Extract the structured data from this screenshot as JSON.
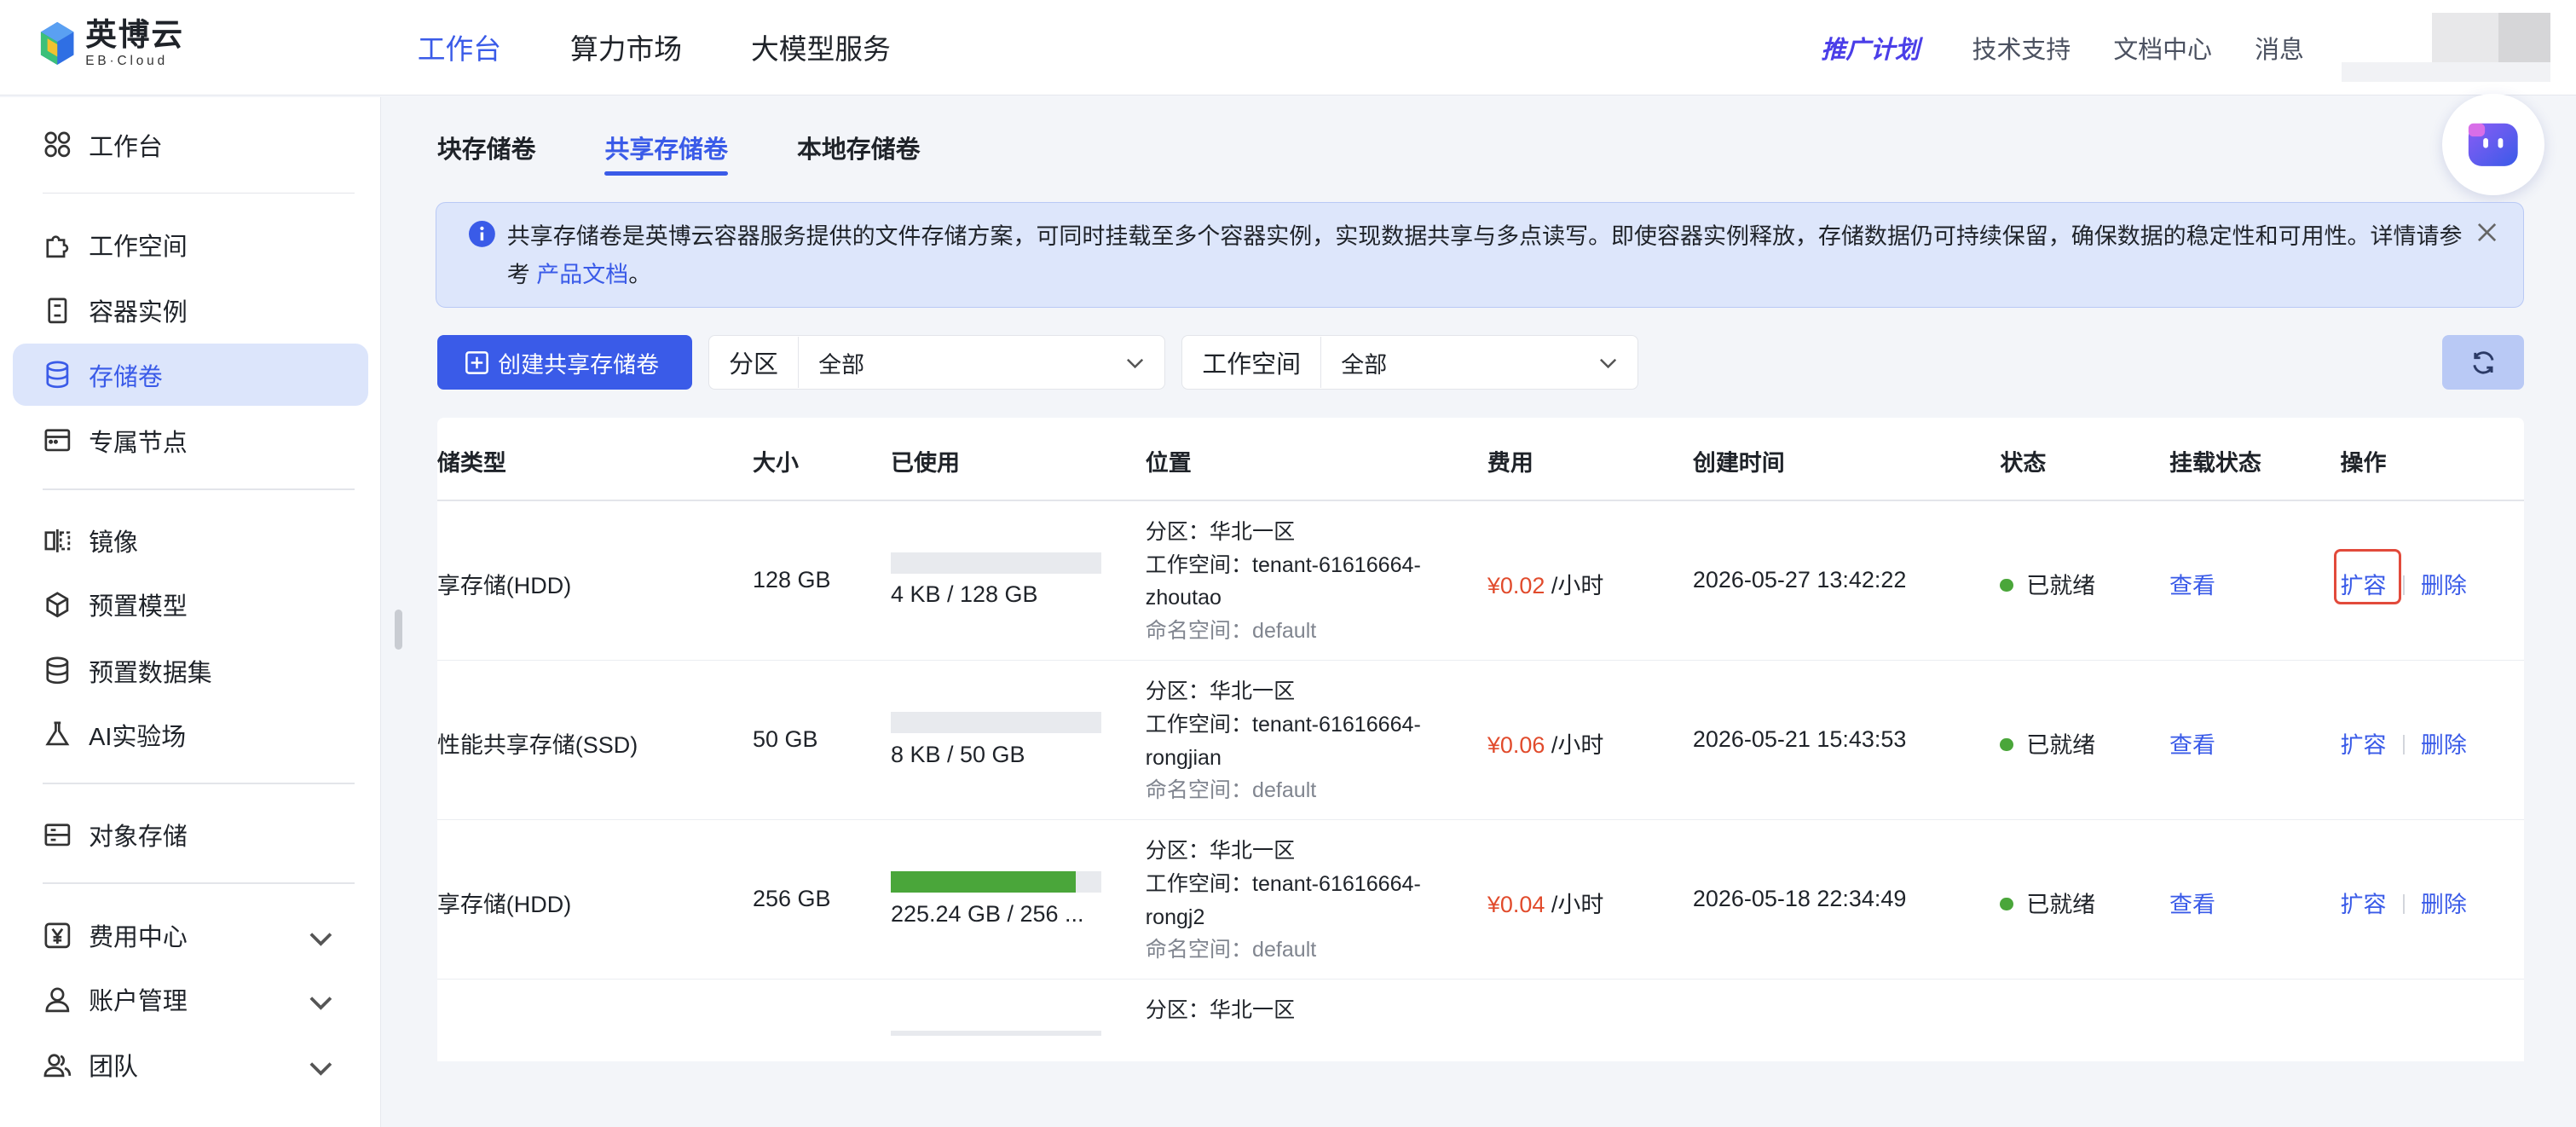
{
  "brand": {
    "name_cn": "英博云",
    "name_en": "EB·Cloud"
  },
  "topnav": {
    "items": [
      {
        "label": "工作台",
        "active": true
      },
      {
        "label": "算力市场",
        "active": false
      },
      {
        "label": "大模型服务",
        "active": false
      }
    ],
    "promo": "推广计划",
    "links": [
      "技术支持",
      "文档中心",
      "消息"
    ]
  },
  "sidebar": {
    "items": [
      {
        "label": "工作台",
        "icon": "grid-icon"
      },
      {
        "label": "工作空间",
        "icon": "puzzle-icon"
      },
      {
        "label": "容器实例",
        "icon": "container-icon"
      },
      {
        "label": "存储卷",
        "icon": "database-icon",
        "active": true
      },
      {
        "label": "专属节点",
        "icon": "node-icon"
      },
      {
        "label": "镜像",
        "icon": "mirror-icon"
      },
      {
        "label": "预置模型",
        "icon": "cube-icon"
      },
      {
        "label": "预置数据集",
        "icon": "dataset-icon"
      },
      {
        "label": "AI实验场",
        "icon": "flask-icon"
      },
      {
        "label": "对象存储",
        "icon": "object-storage-icon"
      },
      {
        "label": "费用中心",
        "icon": "yen-icon",
        "expandable": true
      },
      {
        "label": "账户管理",
        "icon": "user-icon",
        "expandable": true
      },
      {
        "label": "团队",
        "icon": "team-icon",
        "expandable": true
      }
    ]
  },
  "tabs": [
    {
      "label": "块存储卷",
      "active": false
    },
    {
      "label": "共享存储卷",
      "active": true
    },
    {
      "label": "本地存储卷",
      "active": false
    }
  ],
  "notice": {
    "text": "共享存储卷是英博云容器服务提供的文件存储方案，可同时挂载至多个容器实例，实现数据共享与多点读写。即使容器实例释放，存储数据仍可持续保留，确保数据的稳定性和可用性。详情请参考 ",
    "link": "产品文档",
    "suffix": "。"
  },
  "toolbar": {
    "create_label": "创建共享存储卷",
    "partition_label": "分区",
    "partition_value": "全部",
    "workspace_label": "工作空间",
    "workspace_value": "全部"
  },
  "table": {
    "headers": {
      "type": "储类型",
      "size": "大小",
      "used": "已使用",
      "location": "位置",
      "fee": "费用",
      "created": "创建时间",
      "status": "状态",
      "mount": "挂载状态",
      "ops": "操作"
    },
    "rows": [
      {
        "type": "享存储(HDD)",
        "size": "128 GB",
        "used": "4 KB / 128 GB",
        "usage_fraction": 0.0,
        "loc_partition": "分区：华北一区",
        "loc_ws1": "工作空间：tenant-61616664-",
        "loc_ws2": "zhoutao",
        "loc_ns": "命名空间：default",
        "price": "¥0.02",
        "unit": " /小时",
        "created": "2026-05-27 13:42:22",
        "status": "已就绪",
        "mount": "查看",
        "op_expand": "扩容",
        "op_delete": "删除",
        "highlight_expand": true
      },
      {
        "type": "性能共享存储(SSD)",
        "size": "50 GB",
        "used": "8 KB / 50 GB",
        "usage_fraction": 0.0,
        "loc_partition": "分区：华北一区",
        "loc_ws1": "工作空间：tenant-61616664-",
        "loc_ws2": "rongjian",
        "loc_ns": "命名空间：default",
        "price": "¥0.06",
        "unit": " /小时",
        "created": "2026-05-21 15:43:53",
        "status": "已就绪",
        "mount": "查看",
        "op_expand": "扩容",
        "op_delete": "删除"
      },
      {
        "type": "享存储(HDD)",
        "size": "256 GB",
        "used": "225.24 GB / 256 ...",
        "usage_fraction": 0.88,
        "loc_partition": "分区：华北一区",
        "loc_ws1": "工作空间：tenant-61616664-",
        "loc_ws2": "rongj2",
        "loc_ns": "命名空间：default",
        "price": "¥0.04",
        "unit": " /小时",
        "created": "2026-05-18 22:34:49",
        "status": "已就绪",
        "mount": "查看",
        "op_expand": "扩容",
        "op_delete": "删除"
      },
      {
        "loc_partition": "分区：华北一区"
      }
    ]
  },
  "colors": {
    "accent": "#3a5be8",
    "price": "#e14b2c",
    "ready": "#4aa63a",
    "highlight": "#e24a3b"
  }
}
